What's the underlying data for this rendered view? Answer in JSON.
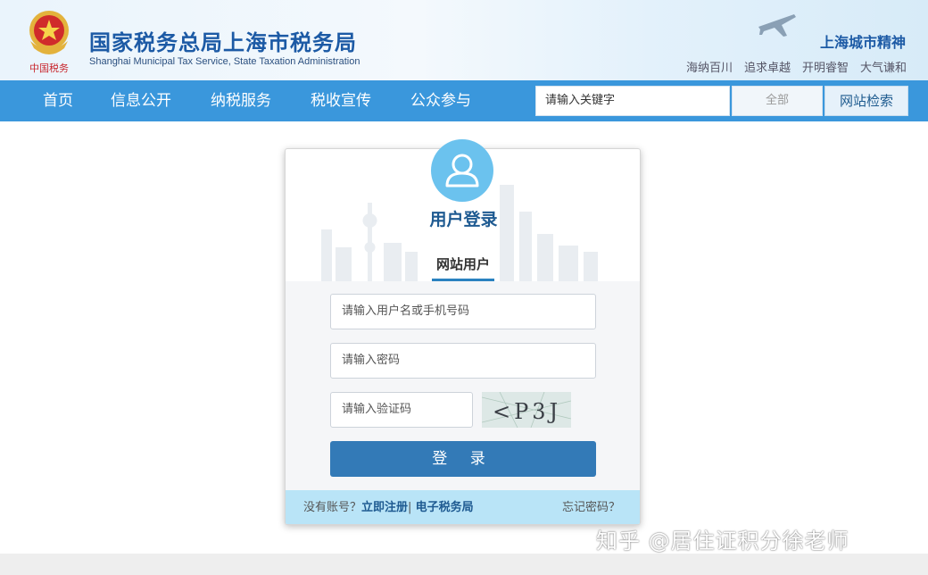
{
  "header": {
    "title": "国家税务总局上海市税务局",
    "subtitle": "Shanghai Municipal Tax Service, State Taxation Administration",
    "emblem_text": "中国税务",
    "spirit_title": "上海城市精神",
    "spirit_words": [
      "海纳百川",
      "追求卓越",
      "开明睿智",
      "大气谦和"
    ]
  },
  "nav": {
    "items": [
      "首页",
      "信息公开",
      "纳税服务",
      "税收宣传",
      "公众参与"
    ],
    "search_placeholder": "请输入关键字",
    "scope": "全部",
    "search_button": "网站检索"
  },
  "login": {
    "title": "用户登录",
    "tab": "网站用户",
    "username_placeholder": "请输入用户名或手机号码",
    "password_placeholder": "请输入密码",
    "captcha_placeholder": "请输入验证码",
    "captcha_text": "<P3J",
    "submit": "登 录",
    "footer": {
      "no_account": "没有账号？",
      "register": "立即注册",
      "separator": "|",
      "e_tax": "电子税务局",
      "forgot": "忘记密码？"
    }
  },
  "watermark": "知乎 @居住证积分徐老师",
  "colors": {
    "brand_blue": "#1c5aa5",
    "nav_blue": "#3a97dc",
    "button_blue": "#337ab7",
    "avatar_blue": "#6bc2ee",
    "footer_bar": "#b9e4f7"
  },
  "icons": {
    "emblem": "tax-emblem-icon",
    "plane": "airplane-icon",
    "avatar": "user-icon"
  }
}
